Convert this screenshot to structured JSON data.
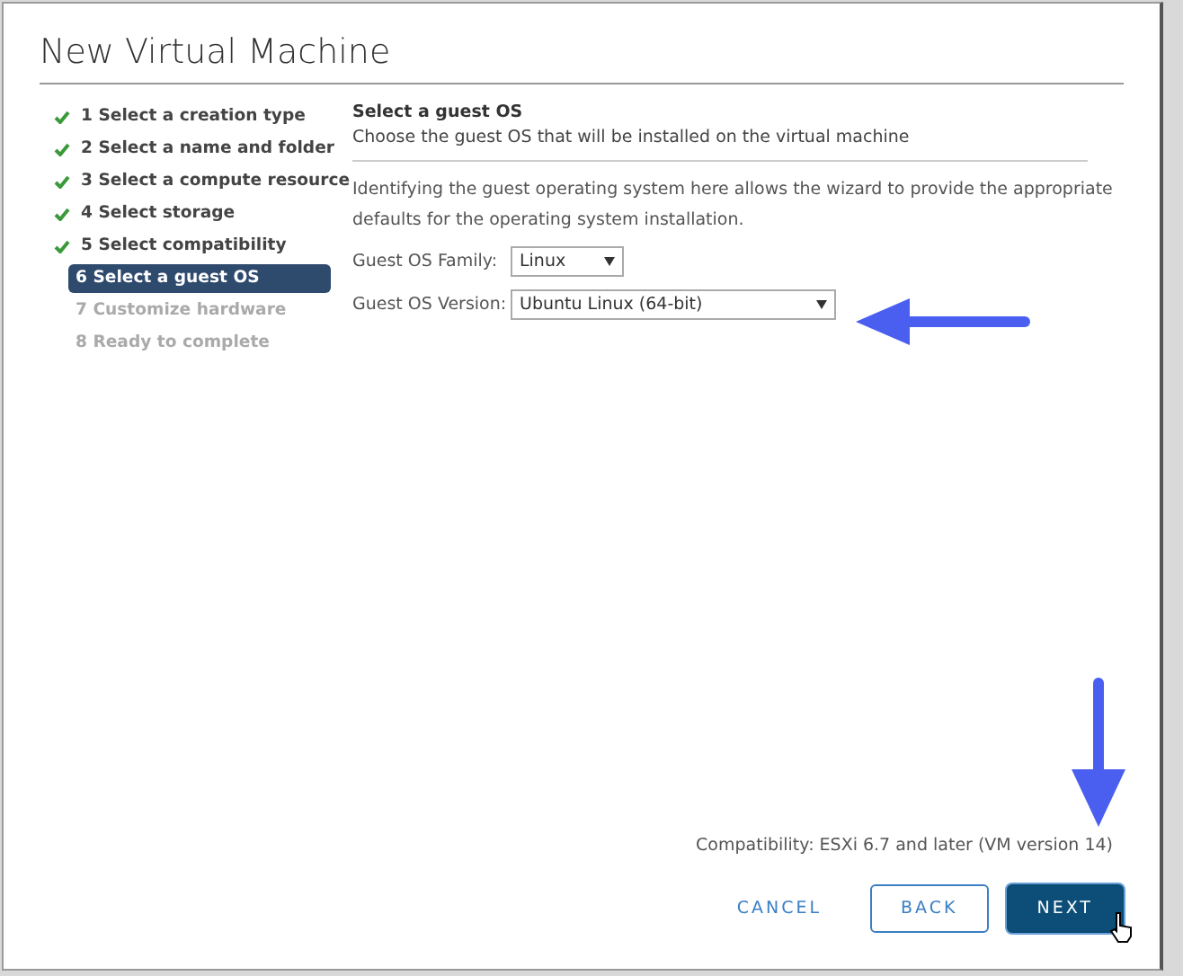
{
  "window": {
    "title": "New Virtual Machine"
  },
  "steps": [
    {
      "label": "1 Select a creation type",
      "completed": true,
      "selected": false,
      "disabled": false
    },
    {
      "label": "2 Select a name and folder",
      "completed": true,
      "selected": false,
      "disabled": false
    },
    {
      "label": "3 Select a compute resource",
      "completed": true,
      "selected": false,
      "disabled": false
    },
    {
      "label": "4 Select storage",
      "completed": true,
      "selected": false,
      "disabled": false
    },
    {
      "label": "5 Select compatibility",
      "completed": true,
      "selected": false,
      "disabled": false
    },
    {
      "label": "6 Select a guest OS",
      "completed": false,
      "selected": true,
      "disabled": false
    },
    {
      "label": "7 Customize hardware",
      "completed": false,
      "selected": false,
      "disabled": true
    },
    {
      "label": "8 Ready to complete",
      "completed": false,
      "selected": false,
      "disabled": true
    }
  ],
  "page": {
    "heading": "Select a guest OS",
    "subheading": "Choose the guest OS that will be installed on the virtual machine",
    "description": "Identifying the guest operating system here allows the wizard to provide the appropriate defaults for the operating system installation.",
    "fields": [
      {
        "label": "Guest OS Family:",
        "value": "Linux"
      },
      {
        "label": "Guest OS Version:",
        "value": "Ubuntu Linux (64-bit)"
      }
    ]
  },
  "compatibility": "Compatibility: ESXi 6.7 and later (VM version 14)",
  "buttons": [
    {
      "label": "CANCEL",
      "kind": "flat"
    },
    {
      "label": "BACK",
      "kind": "outline"
    },
    {
      "label": "NEXT",
      "kind": "primary"
    }
  ]
}
